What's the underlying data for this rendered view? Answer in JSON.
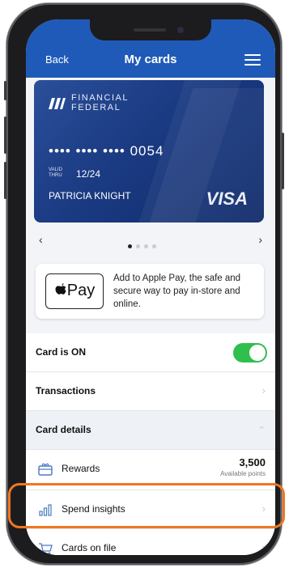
{
  "header": {
    "back_label": "Back",
    "title": "My cards"
  },
  "card": {
    "bank_line1": "FINANCIAL",
    "bank_line2": "FEDERAL",
    "number_masked": "•••• •••• •••• 0054",
    "valid_line1": "VALID",
    "valid_line2": "THRU",
    "expiry": "12/24",
    "holder": "PATRICIA KNIGHT",
    "network": "VISA"
  },
  "pager": {
    "prev": "‹",
    "next": "›",
    "total": 4,
    "active": 1
  },
  "apple_pay": {
    "badge_text": "Pay",
    "description": "Add to Apple Pay, the safe and secure way to pay in-store and online."
  },
  "card_status": {
    "label": "Card is ON",
    "on": true,
    "toggle_color": "#2fbf4c"
  },
  "transactions": {
    "label": "Transactions"
  },
  "card_details": {
    "label": "Card details",
    "rewards": {
      "label": "Rewards",
      "points": "3,500",
      "caption": "Available points"
    },
    "spend_insights": {
      "label": "Spend insights"
    },
    "cards_on_file": {
      "label": "Cards on file"
    }
  },
  "colors": {
    "header_bg": "#1f5ab8",
    "highlight": "#ef7622"
  },
  "icons": {
    "rewards": "gift-card-icon",
    "spend_insights": "bar-chart-icon",
    "cards_on_file": "cart-icon"
  }
}
